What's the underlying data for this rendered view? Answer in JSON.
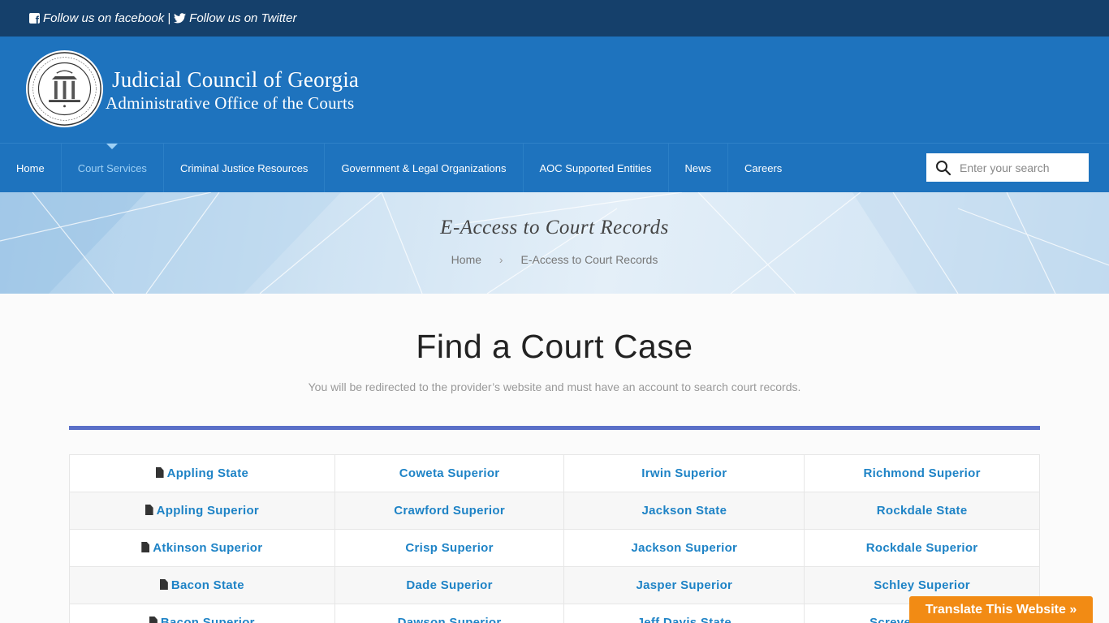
{
  "topbar": {
    "facebook": "Follow us on facebook",
    "separator": "|",
    "twitter": "Follow us on Twitter"
  },
  "header": {
    "title": "Judicial Council of Georgia",
    "subtitle": "Administrative Office of the Courts"
  },
  "nav": {
    "items": [
      {
        "label": "Home"
      },
      {
        "label": "Court Services",
        "active": true
      },
      {
        "label": "Criminal Justice Resources"
      },
      {
        "label": "Government & Legal Organizations"
      },
      {
        "label": "AOC Supported Entities"
      },
      {
        "label": "News"
      },
      {
        "label": "Careers"
      }
    ],
    "search_placeholder": "Enter your search"
  },
  "banner": {
    "title": "E-Access to Court Records",
    "breadcrumb": [
      "Home",
      "E-Access to Court Records"
    ]
  },
  "main": {
    "title": "Find a Court Case",
    "subtitle": "You will be redirected to the provider’s website and must have an account to search court records."
  },
  "courts": {
    "rows": [
      [
        "Appling State",
        "Coweta Superior",
        "Irwin Superior",
        "Richmond Superior"
      ],
      [
        "Appling Superior",
        "Crawford Superior",
        "Jackson State",
        "Rockdale State"
      ],
      [
        "Atkinson Superior",
        "Crisp Superior",
        "Jackson Superior",
        "Rockdale Superior"
      ],
      [
        "Bacon State",
        "Dade Superior",
        "Jasper Superior",
        "Schley Superior"
      ],
      [
        "Bacon Superior",
        "Dawson Superior",
        "Jeff Davis State",
        "Screven Superior"
      ]
    ]
  },
  "translate": {
    "label": "Translate This Website »"
  },
  "colors": {
    "topbar": "#15406b",
    "header": "#1e73be",
    "link": "#1e83c6",
    "divider": "#5a6fc8",
    "translate": "#f28b14"
  }
}
